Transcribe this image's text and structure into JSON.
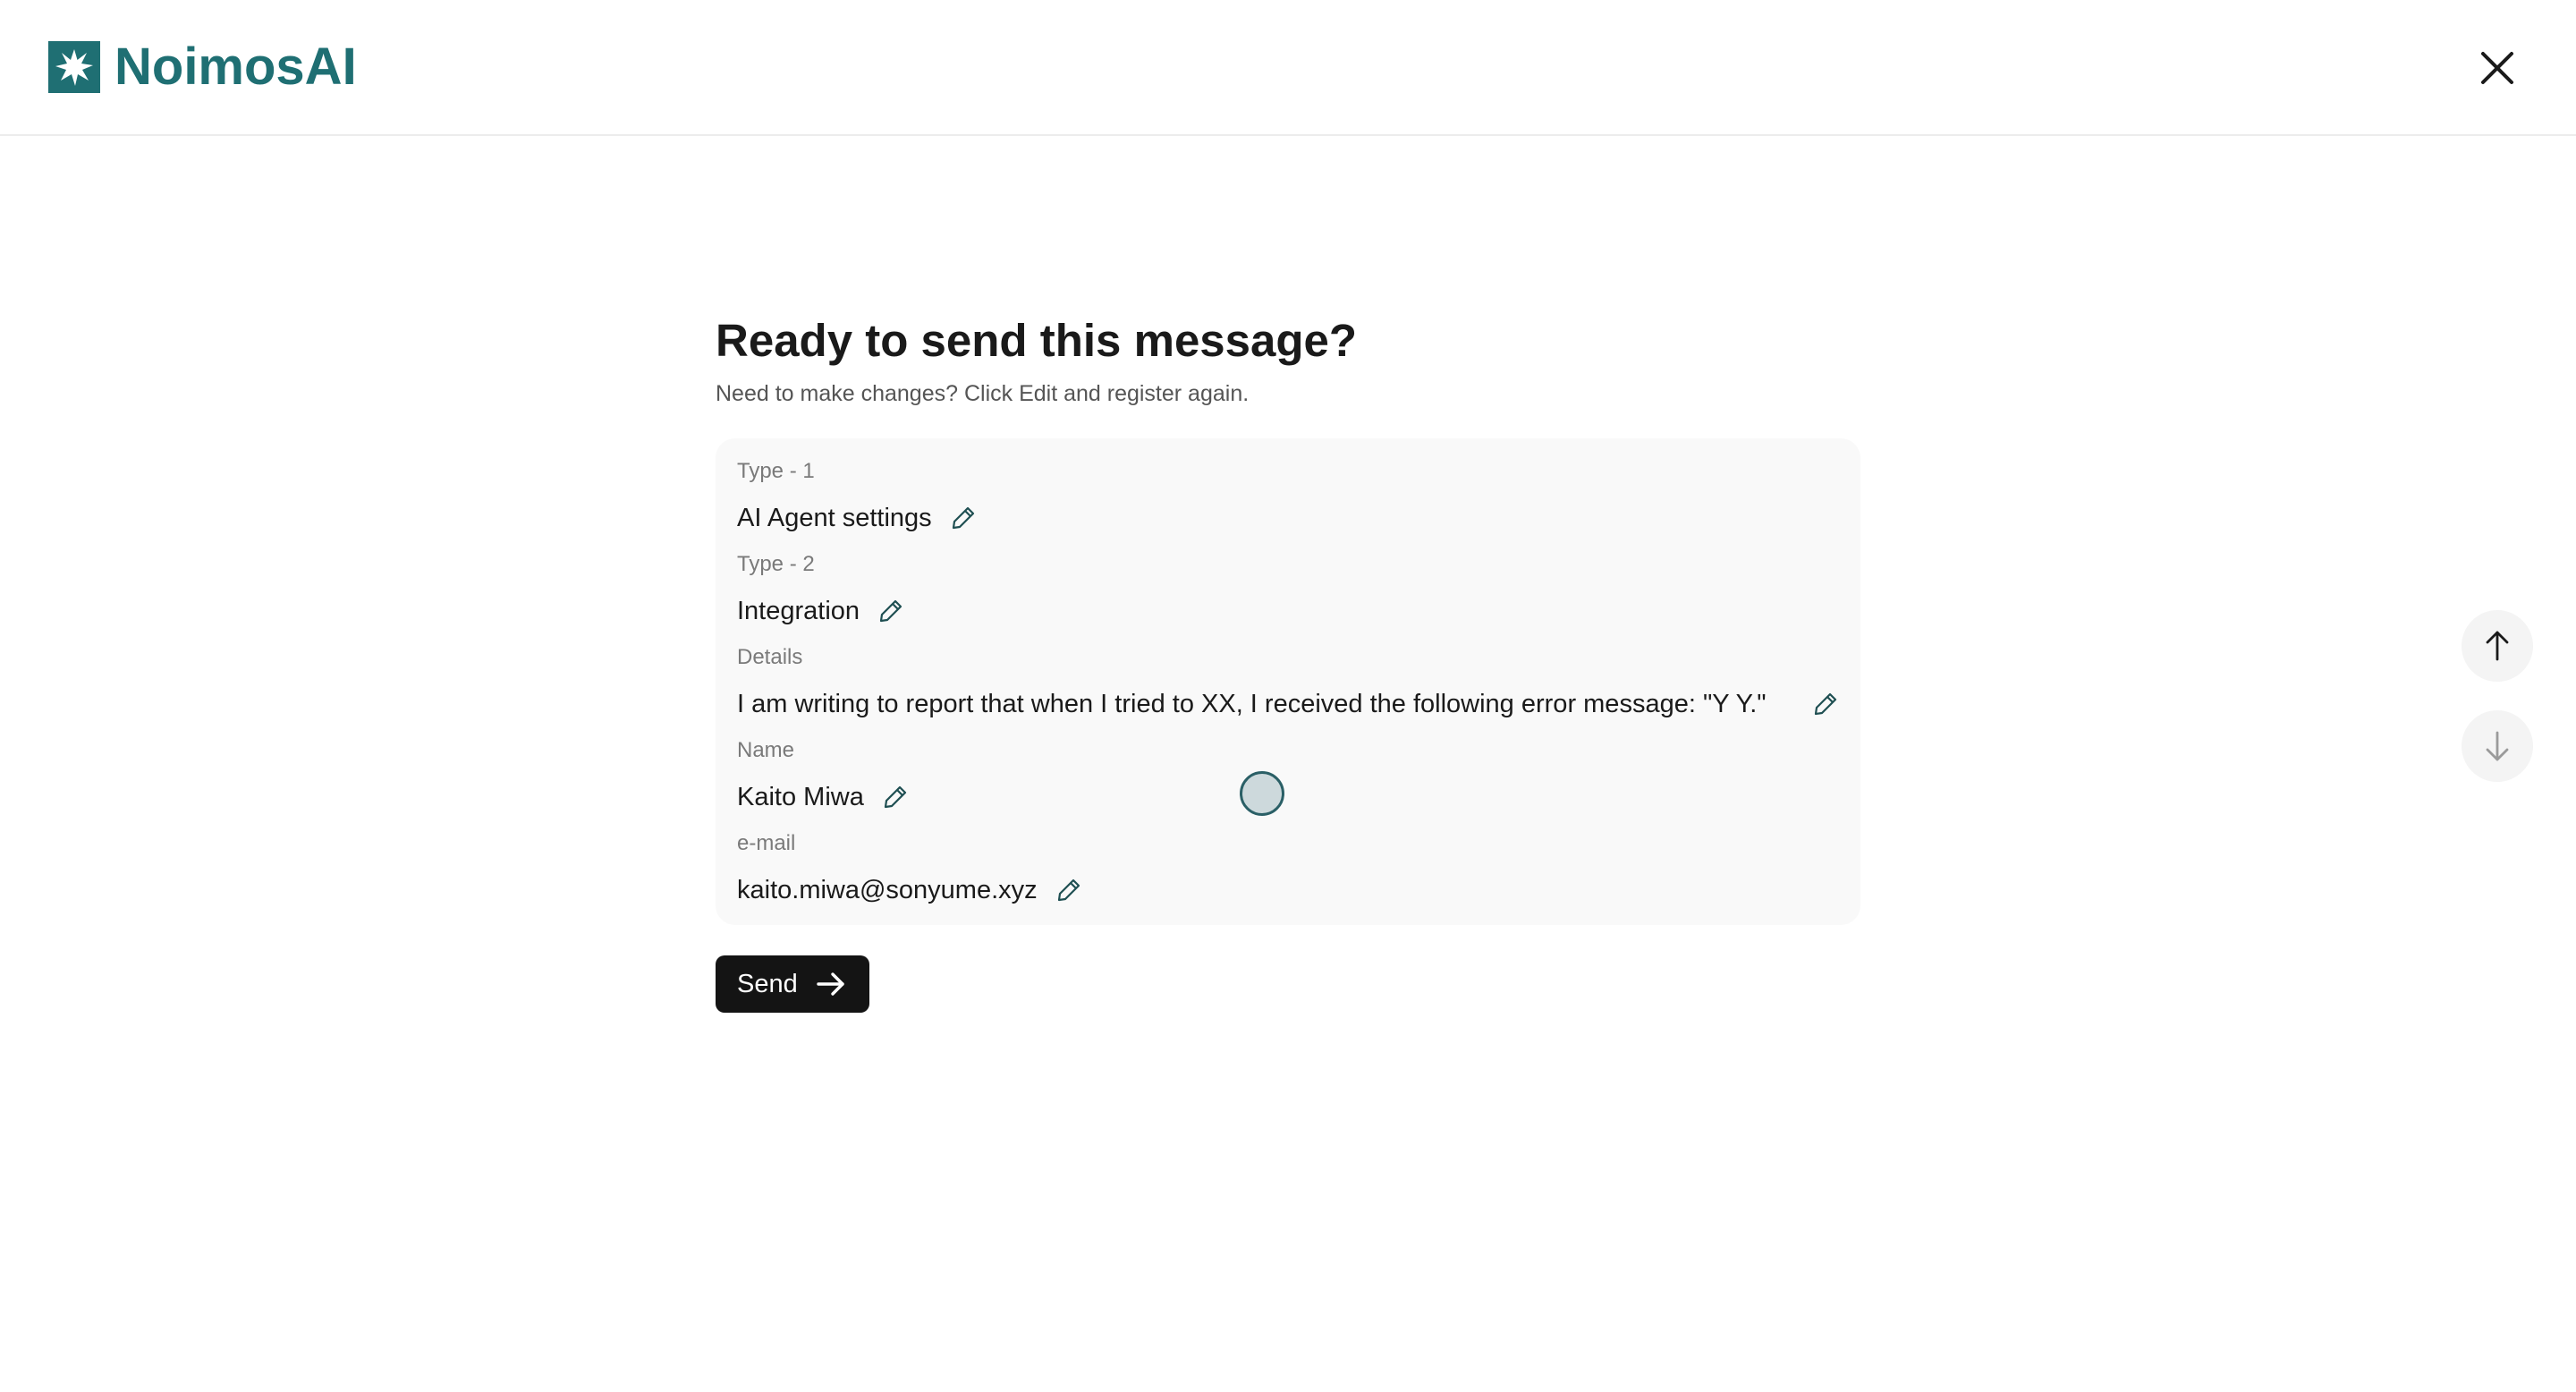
{
  "app": {
    "name": "NoimosAI",
    "brand_color": "#1f6f73"
  },
  "header": {
    "logo_icon": "burst-logo-icon",
    "close_icon": "close-icon"
  },
  "main": {
    "title": "Ready to send this message?",
    "subtitle": "Need to make changes? Click Edit and register again."
  },
  "fields": [
    {
      "label": "Type - 1",
      "value": "AI Agent settings",
      "icon": "pencil-icon"
    },
    {
      "label": "Type - 2",
      "value": "Integration",
      "icon": "pencil-icon"
    },
    {
      "label": "Details",
      "value": "I am writing to report that when I tried to XX, I received the following error message: \"Y Y.\"",
      "icon": "pencil-icon"
    },
    {
      "label": "Name",
      "value": "Kaito Miwa",
      "icon": "pencil-icon"
    },
    {
      "label": "e-mail",
      "value": "kaito.miwa@sonyume.xyz",
      "icon": "pencil-icon"
    }
  ],
  "actions": {
    "send_label": "Send",
    "send_icon": "arrow-right-icon"
  },
  "scroll": {
    "up_icon": "arrow-up-icon",
    "down_icon": "arrow-down-icon"
  }
}
